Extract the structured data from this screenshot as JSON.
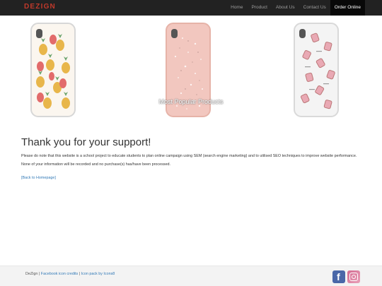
{
  "navbar": {
    "brand": "DEZIGN",
    "items": [
      {
        "label": "Home",
        "active": false
      },
      {
        "label": "Product",
        "active": false
      },
      {
        "label": "About Us",
        "active": false
      },
      {
        "label": "Contact Us",
        "active": false
      },
      {
        "label": "Order Online",
        "active": true
      }
    ]
  },
  "carousel": {
    "caption": "Most Popular Products",
    "products": [
      {
        "icon": "pineapple-pattern-phone-case"
      },
      {
        "icon": "pink-glitter-phone-case"
      },
      {
        "icon": "perfume-bottle-phone-case"
      }
    ]
  },
  "main": {
    "heading": "Thank you for your support!",
    "para1": "Please do note that this website is a school project to educate students to plan online campaign using SEM (search engine marketing) and to utilised SEO techniques to improve website performance.",
    "para2": "None of your information will be recorded and no purchase(s) has/have been processed.",
    "back_link": "[Back to Homepage]"
  },
  "footer": {
    "brand": "DeZign",
    "sep1": " | ",
    "link1": "Facebook icon credits",
    "sep2": " | ",
    "link2": "Icon pack by Icons8",
    "icons": [
      "facebook-icon",
      "instagram-icon"
    ]
  },
  "colors": {
    "navbar_bg": "#222222",
    "brand": "#c0392b",
    "link": "#337ab7",
    "footer_bg": "#f3f3f3"
  }
}
